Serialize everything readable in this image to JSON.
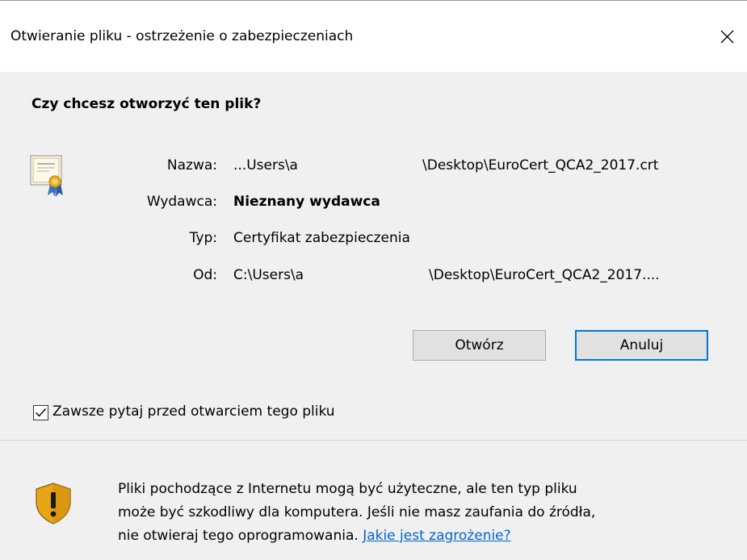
{
  "window": {
    "title": "Otwieranie pliku - ostrzeżenie o zabezpieczeniach"
  },
  "dialog": {
    "heading": "Czy chcesz otworzyć ten plik?",
    "fields": {
      "name": {
        "label": "Nazwa:",
        "value_part1": "...Users\\a",
        "value_part2": "\\Desktop\\EuroCert_QCA2_2017.crt"
      },
      "publisher": {
        "label": "Wydawca:",
        "value": "Nieznany wydawca"
      },
      "type": {
        "label": "Typ:",
        "value": "Certyfikat zabezpieczenia"
      },
      "from": {
        "label": "Od:",
        "value_part1": "C:\\Users\\a",
        "value_part2": "\\Desktop\\EuroCert_QCA2_2017...."
      }
    },
    "buttons": {
      "open": "Otwórz",
      "cancel": "Anuluj"
    },
    "checkbox": {
      "label": "Zawsze pytaj przed otwarciem tego pliku",
      "checked": true
    }
  },
  "warning": {
    "line1": "Pliki pochodzące z Internetu mogą być użyteczne, ale ten typ pliku",
    "line2": "może być szkodliwy dla komputera. Jeśli nie masz zaufania do źródła,",
    "line3": "nie otwieraj tego oprogramowania.",
    "link": "Jakie jest zagrożenie?"
  },
  "icons": {
    "close": "close-icon",
    "certificate": "certificate-icon",
    "checkmark": "checkmark-icon",
    "shield": "shield-warning-icon"
  },
  "colors": {
    "panel_bg": "#f0f0f0",
    "accent": "#0078d7",
    "link": "#0066cc"
  }
}
